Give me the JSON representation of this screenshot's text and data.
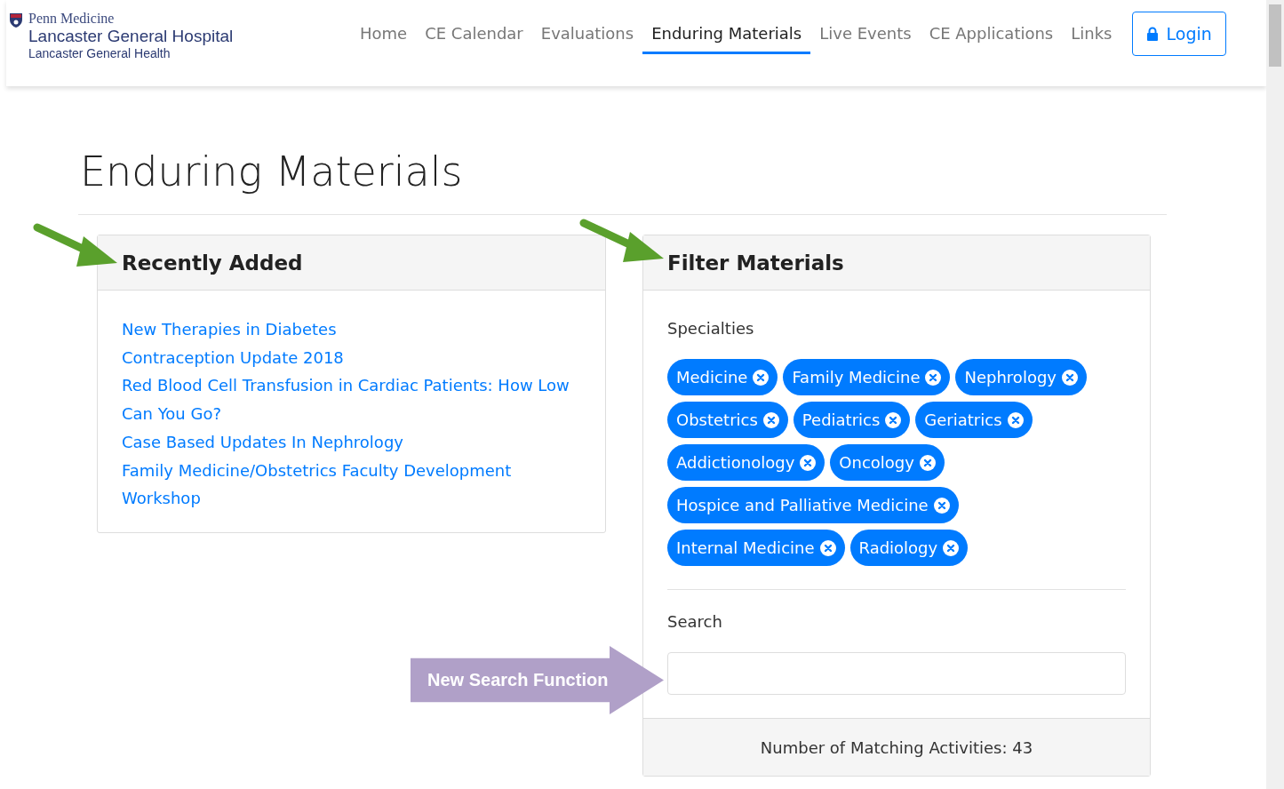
{
  "header": {
    "logo": {
      "brand": "Penn Medicine",
      "name": "Lancaster General Hospital",
      "subtitle": "Lancaster General Health"
    },
    "nav": [
      {
        "label": "Home",
        "selected": false
      },
      {
        "label": "CE Calendar",
        "selected": false
      },
      {
        "label": "Evaluations",
        "selected": false
      },
      {
        "label": "Enduring Materials",
        "selected": true
      },
      {
        "label": "Live Events",
        "selected": false
      },
      {
        "label": "CE Applications",
        "selected": false
      },
      {
        "label": "Links",
        "selected": false
      }
    ],
    "login": "Login"
  },
  "page_title": "Enduring Materials",
  "recently_added": {
    "title": "Recently Added",
    "links": [
      "New Therapies in Diabetes",
      "Contraception Update 2018",
      "Red Blood Cell Transfusion in Cardiac Patients: How Low Can You Go?",
      "Case Based Updates In Nephrology",
      "Family Medicine/Obstetrics Faculty Development Workshop"
    ]
  },
  "filter": {
    "title": "Filter Materials",
    "specialties_label": "Specialties",
    "specialties": [
      "Medicine",
      "Family Medicine",
      "Nephrology",
      "Obstetrics",
      "Pediatrics",
      "Geriatrics",
      "Addictionology",
      "Oncology",
      "Hospice and Palliative Medicine",
      "Internal Medicine",
      "Radiology"
    ],
    "search_label": "Search",
    "footer": "Number of Matching Activities: 43"
  },
  "callout": "New Search Function"
}
